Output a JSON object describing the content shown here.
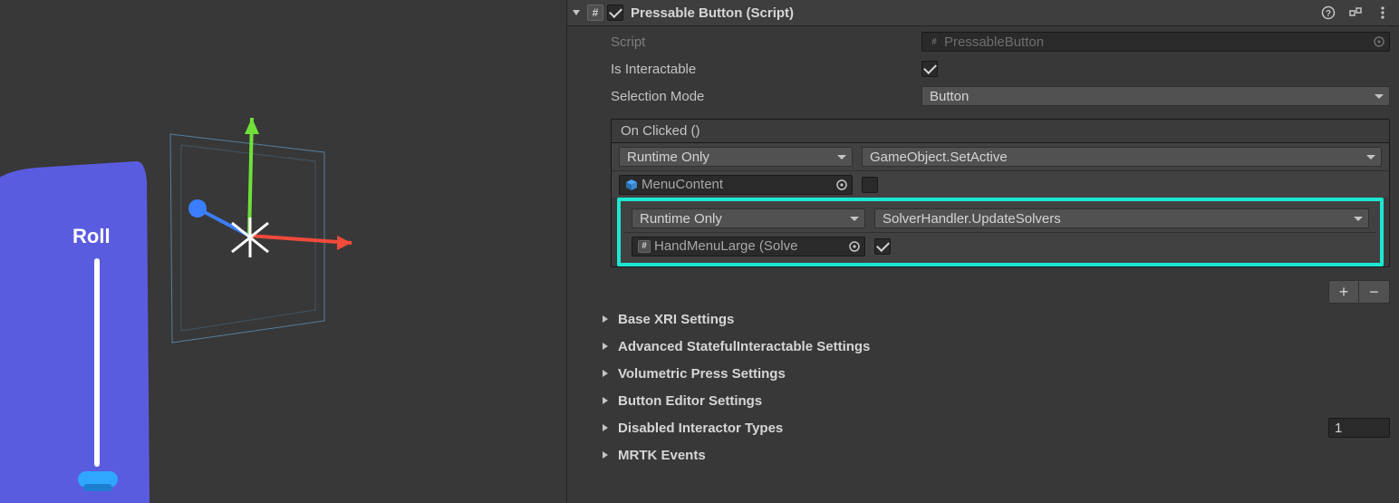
{
  "scene": {
    "label": "Roll"
  },
  "component": {
    "title": "Pressable Button (Script)",
    "enabled": true,
    "fields": {
      "script_label": "Script",
      "script_value": "PressableButton",
      "is_interactable_label": "Is Interactable",
      "is_interactable": true,
      "selection_mode_label": "Selection Mode",
      "selection_mode": "Button"
    },
    "on_clicked": {
      "header": "On Clicked ()",
      "entries": [
        {
          "call_state": "Runtime Only",
          "target": "MenuContent",
          "target_icon": "cube",
          "function": "GameObject.SetActive",
          "bool_arg": false
        },
        {
          "call_state": "Runtime Only",
          "target": "HandMenuLarge (Solve",
          "target_icon": "script",
          "function": "SolverHandler.UpdateSolvers",
          "bool_arg": true,
          "highlighted": true
        }
      ]
    },
    "sections": {
      "base_xri": "Base XRI Settings",
      "advanced_si": "Advanced StatefulInteractable Settings",
      "volumetric": "Volumetric Press Settings",
      "button_editor": "Button Editor Settings",
      "disabled_interactor": "Disabled Interactor Types",
      "disabled_interactor_count": "1",
      "mrtk_events": "MRTK Events"
    }
  }
}
